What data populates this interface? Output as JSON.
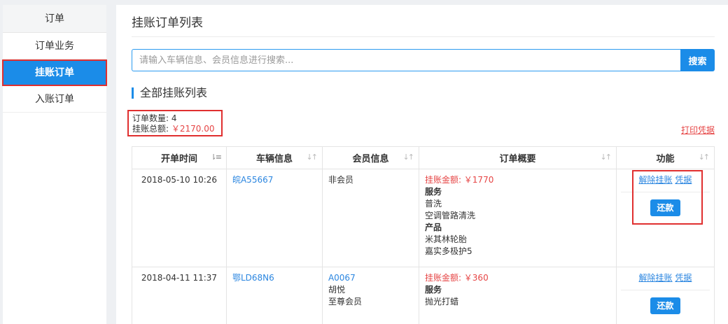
{
  "sidebar": {
    "header": "订单",
    "items": [
      {
        "label": "订单业务"
      },
      {
        "label": "挂账订单"
      },
      {
        "label": "入账订单"
      }
    ]
  },
  "page_title": "挂账订单列表",
  "search": {
    "placeholder": "请输入车辆信息、会员信息进行搜索...",
    "button": "搜索"
  },
  "section_title": "全部挂账列表",
  "summary": {
    "count_label": "订单数量:",
    "count_value": "4",
    "total_label": "挂账总额:",
    "total_value": "￥2170.00"
  },
  "print_link": "打印凭据",
  "table": {
    "columns": [
      "开单时间",
      "车辆信息",
      "会员信息",
      "订单概要",
      "功能"
    ],
    "rows": [
      {
        "time": "2018-05-10 10:26",
        "vehicle": "皖A55667",
        "member_code": "",
        "member_lines": [
          "非会员"
        ],
        "amount": "挂账金额: ￥1770",
        "service_title": "服务",
        "services": [
          "普洗",
          "空调管路清洗"
        ],
        "product_title": "产品",
        "products": [
          "米其林轮胎",
          "嘉实多极护5"
        ],
        "op_cancel": "解除挂账",
        "op_voucher": "凭据",
        "op_repay": "还款"
      },
      {
        "time": "2018-04-11 11:37",
        "vehicle": "鄂LD68N6",
        "member_code": "A0067",
        "member_lines": [
          "胡悦",
          "至尊会员"
        ],
        "amount": "挂账金额: ￥360",
        "service_title": "服务",
        "services": [
          "抛光打蜡"
        ],
        "product_title": "",
        "products": [],
        "op_cancel": "解除挂账",
        "op_voucher": "凭据",
        "op_repay": "还款"
      }
    ]
  },
  "colors": {
    "accent": "#1b8ce8",
    "link": "#2b86e0",
    "amount_red": "#e64545",
    "highlight_red": "#e02f2f"
  },
  "icons": {
    "sort_active": "sort-desc-icon",
    "sort": "sort-icon"
  }
}
